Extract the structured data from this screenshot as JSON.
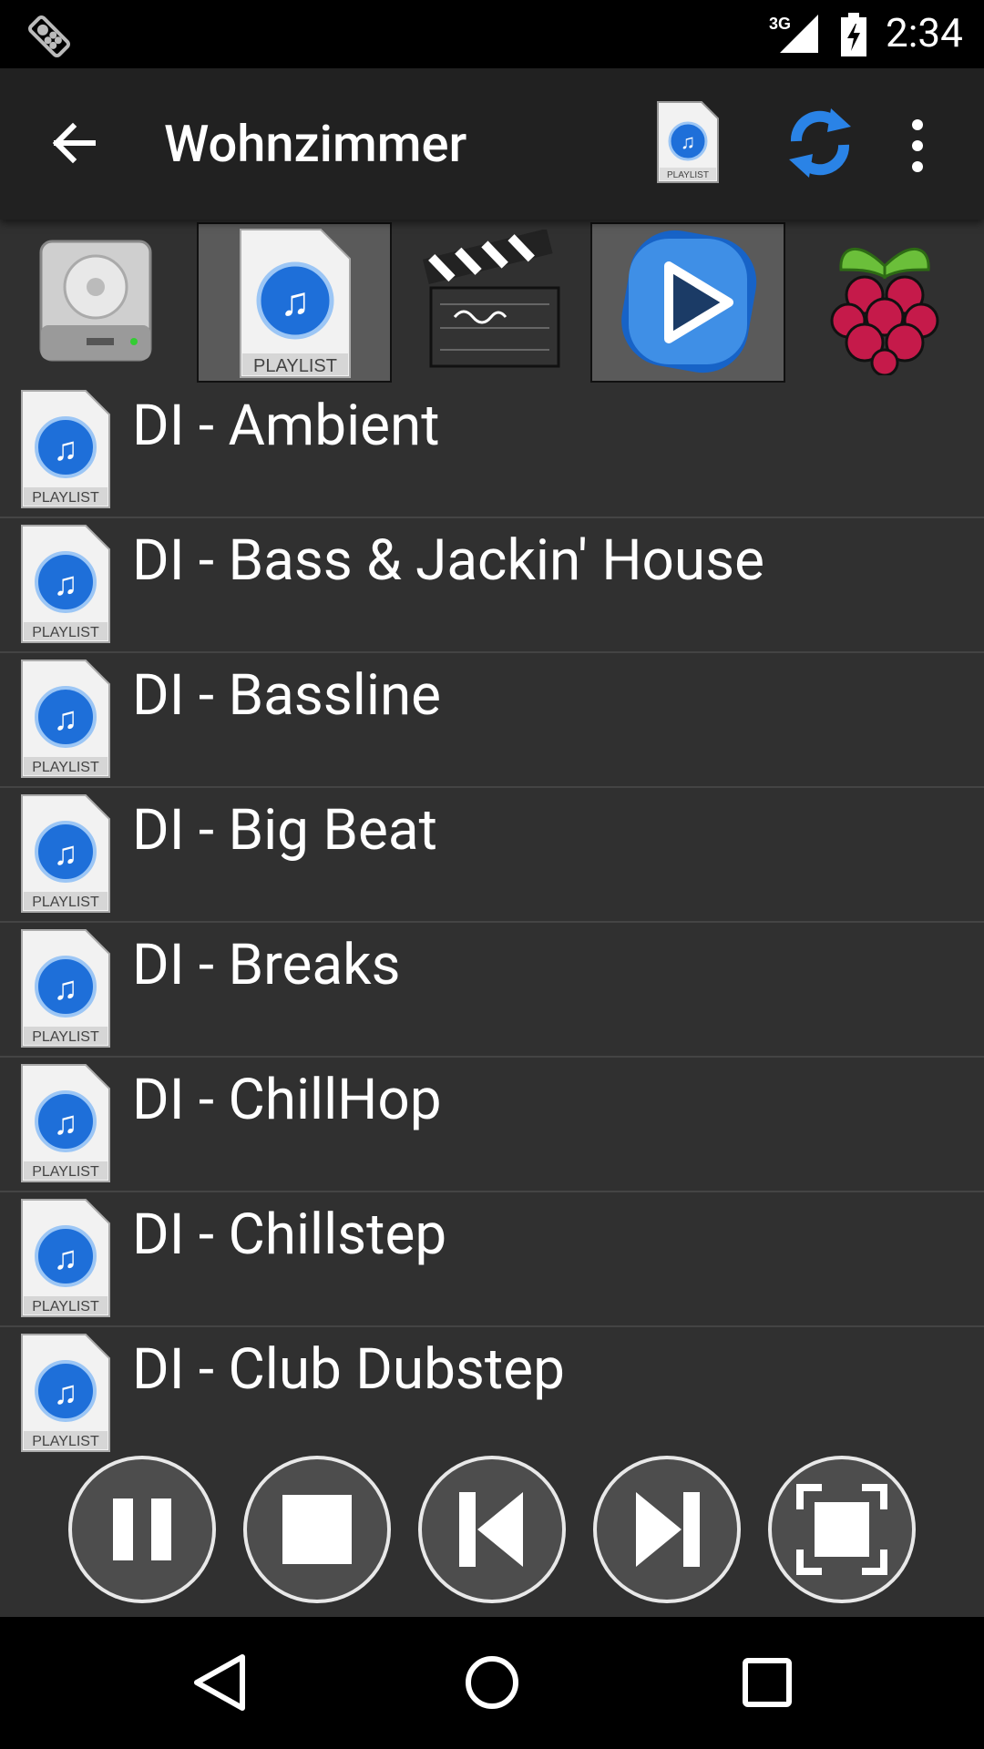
{
  "status_bar": {
    "time": "2:34",
    "network": "3G",
    "icons": [
      "remote-control-icon",
      "signal-3g-icon",
      "battery-charging-icon"
    ]
  },
  "toolbar": {
    "title": "Wohnzimmer",
    "icons": [
      "back-arrow-icon",
      "playlist-icon",
      "refresh-icon",
      "more-vert-icon"
    ]
  },
  "sources": [
    {
      "name": "hard-drive-icon",
      "selected": false
    },
    {
      "name": "playlist-icon",
      "selected": true
    },
    {
      "name": "clapperboard-icon",
      "selected": false
    },
    {
      "name": "play-icon",
      "selected": true
    },
    {
      "name": "raspberry-pi-icon",
      "selected": false
    }
  ],
  "playlists": [
    {
      "label": "DI - Ambient"
    },
    {
      "label": "DI - Bass & Jackin' House"
    },
    {
      "label": "DI - Bassline"
    },
    {
      "label": "DI - Big Beat"
    },
    {
      "label": "DI - Breaks"
    },
    {
      "label": "DI - ChillHop"
    },
    {
      "label": "DI - Chillstep"
    },
    {
      "label": "DI - Club Dubstep"
    }
  ],
  "playlist_icon_text": "PLAYLIST",
  "controls": [
    "pause-icon",
    "stop-icon",
    "previous-icon",
    "next-icon",
    "fullscreen-icon"
  ],
  "navbar": [
    "back-nav-icon",
    "home-nav-icon",
    "recents-nav-icon"
  ],
  "colors": {
    "background": "#303030",
    "toolbar": "#212121",
    "status_bar": "#000000",
    "divider": "#444444",
    "accent_blue": "#1e88e5"
  }
}
